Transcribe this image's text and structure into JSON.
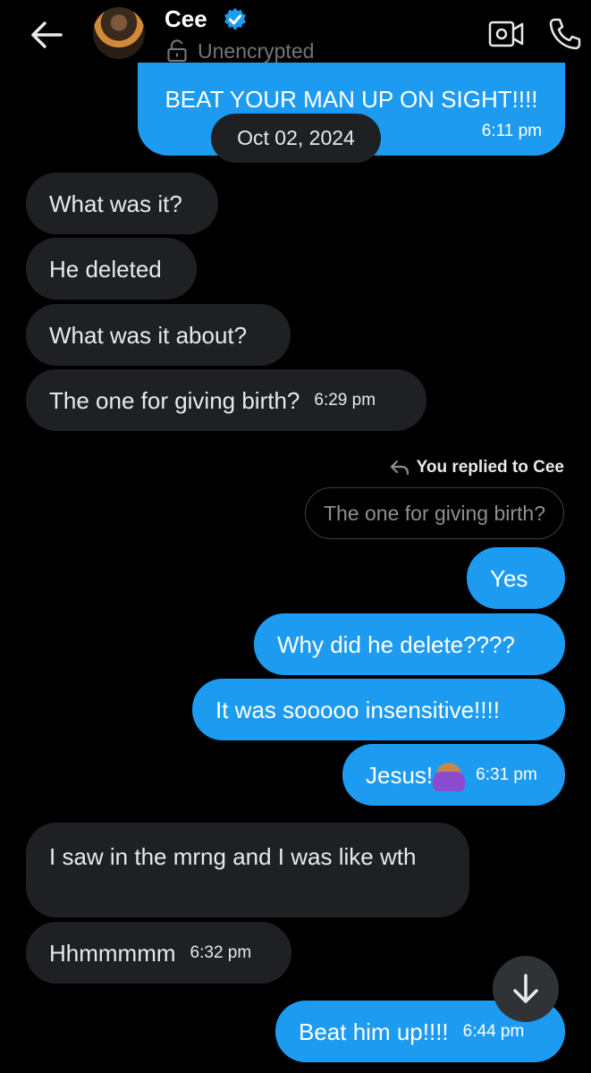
{
  "header": {
    "contact_name": "Cee",
    "encryption_status": "Unencrypted",
    "icons": [
      "back-arrow-icon",
      "verified-badge-icon",
      "lock-open-icon",
      "video-call-icon",
      "phone-call-icon"
    ],
    "accent": "#1d9bf0"
  },
  "messages": {
    "m0": {
      "text": "BEAT YOUR MAN UP ON SIGHT!!!!",
      "time": "6:11 pm"
    },
    "date_separator": "Oct 02, 2024",
    "m1": {
      "text": "What was it?"
    },
    "m2": {
      "text": "He deleted"
    },
    "m3": {
      "text": "What was it about?"
    },
    "m4": {
      "text": "The one for giving birth?",
      "time": "6:29 pm"
    },
    "reply_label": "You replied to Cee",
    "reply_quote": "The one for giving birth?",
    "m5": {
      "text": "Yes"
    },
    "m6": {
      "text": "Why did he delete????"
    },
    "m7": {
      "text": "It was sooooo insensitive!!!!"
    },
    "m8": {
      "text": "Jesus!",
      "emoji": "woman-facepalming",
      "time": "6:31 pm"
    },
    "m9": {
      "text": "I saw in the mrng and I was like wth"
    },
    "m10": {
      "text": "Hhmmmmm",
      "time": "6:32 pm"
    },
    "m11": {
      "text": "Beat him up!!!!",
      "time": "6:44 pm"
    }
  },
  "colors": {
    "incoming_bubble": "#1e2023",
    "outgoing_bubble": "#1d9bf0",
    "background": "#000000"
  }
}
